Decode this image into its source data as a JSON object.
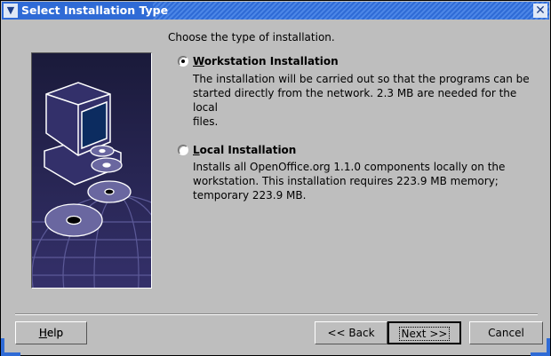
{
  "window": {
    "title": "Select Installation Type"
  },
  "prompt": "Choose the type of installation.",
  "options": [
    {
      "label": "Workstation Installation",
      "mnemonic": "W",
      "rest": "orkstation Installation",
      "selected": true,
      "description_lines": [
        "The installation will be carried out so that the programs can be",
        "started directly from the network. 2.3 MB are needed for the local",
        "files."
      ]
    },
    {
      "label": "Local Installation",
      "mnemonic": "L",
      "rest": "ocal Installation",
      "selected": false,
      "description_lines": [
        "Installs all OpenOffice.org 1.1.0 components locally on the",
        "workstation. This installation requires 223.9 MB memory;",
        "temporary 223.9 MB."
      ]
    }
  ],
  "buttons": {
    "help": "Help",
    "help_m": "H",
    "help_rest": "elp",
    "back": "<< Back",
    "next": "Next >>",
    "cancel": "Cancel"
  }
}
